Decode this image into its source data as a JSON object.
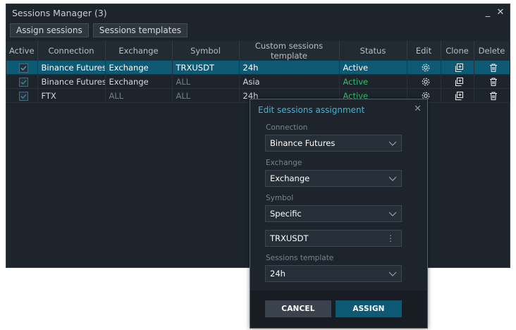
{
  "window": {
    "title": "Sessions Manager (3)",
    "minimize_glyph": "_",
    "close_glyph": "✕"
  },
  "toolbar": {
    "assign_sessions_label": "Assign sessions",
    "sessions_templates_label": "Sessions templates"
  },
  "table": {
    "headers": [
      "Active",
      "Connection",
      "Exchange",
      "Symbol",
      "Custom sessions template",
      "Status",
      "Edit",
      "Clone",
      "Delete"
    ],
    "rows": [
      {
        "active": true,
        "connection": "Binance Futures",
        "exchange": "Exchange",
        "symbol": "TRXUSDT",
        "template": "24h",
        "status": "Active",
        "selected": true
      },
      {
        "active": true,
        "connection": "Binance Futures",
        "exchange": "Exchange",
        "symbol": "ALL",
        "template": "Asia",
        "status": "Active",
        "selected": false
      },
      {
        "active": true,
        "connection": "FTX",
        "exchange": "ALL",
        "symbol": "ALL",
        "template": "24h",
        "status": "Active",
        "selected": false
      }
    ],
    "icons": {
      "edit": "gear-icon",
      "clone": "clone-icon",
      "delete": "trash-icon"
    }
  },
  "dialog": {
    "title": "Edit sessions assignment",
    "close_glyph": "✕",
    "connection_label": "Connection",
    "connection_value": "Binance Futures",
    "exchange_label": "Exchange",
    "exchange_value": "Exchange",
    "symbol_label": "Symbol",
    "symbol_value": "Specific",
    "symbol_input_value": "TRXUSDT",
    "sessions_template_label": "Sessions template",
    "sessions_template_value": "24h",
    "cancel_label": "CANCEL",
    "assign_label": "ASSIGN"
  },
  "colors": {
    "accent": "#0e5a74",
    "title_accent": "#3fb6d8",
    "status_active": "#2ec26b",
    "background": "#1d242c"
  }
}
